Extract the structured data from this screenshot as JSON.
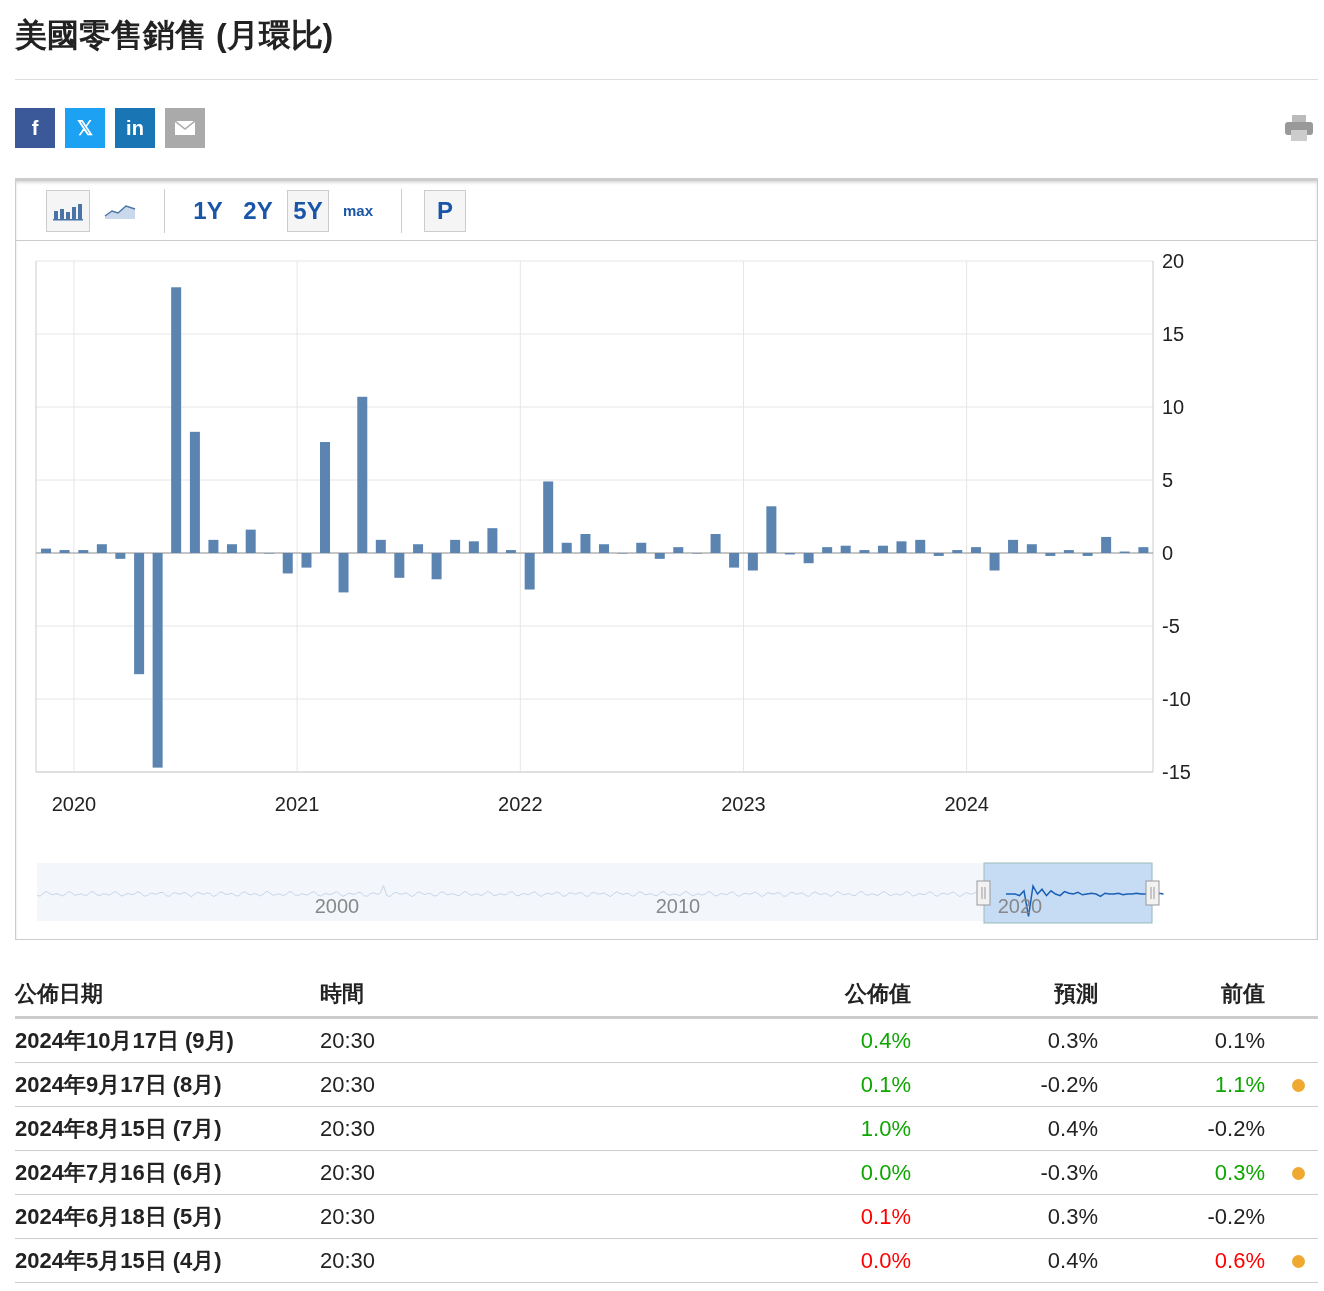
{
  "title": "美國零售銷售 (月環比)",
  "share": [
    {
      "kind": "facebook",
      "label": "f"
    },
    {
      "kind": "x",
      "label": "𝕏"
    },
    {
      "kind": "linkedin",
      "label": "in"
    },
    {
      "kind": "mail"
    }
  ],
  "toolbar": {
    "chart_types": [
      {
        "kind": "bar",
        "selected": true
      },
      {
        "kind": "line",
        "selected": false
      }
    ],
    "ranges": [
      {
        "label": "1Y",
        "selected": false
      },
      {
        "label": "2Y",
        "selected": false
      },
      {
        "label": "5Y",
        "selected": true
      },
      {
        "label": "max",
        "selected": false
      }
    ],
    "extra_button": "P"
  },
  "chart": {
    "chart_data": {
      "type": "bar",
      "grid": true,
      "ylim": [
        -15,
        20
      ],
      "yticks": [
        {
          "value": -15,
          "label": "-15"
        },
        {
          "value": -10,
          "label": "-10"
        },
        {
          "value": -5,
          "label": "-5"
        },
        {
          "value": 0,
          "label": "0"
        },
        {
          "value": 5,
          "label": "5"
        },
        {
          "value": 10,
          "label": "10"
        },
        {
          "value": 15,
          "label": "15"
        },
        {
          "value": 20,
          "label": "20"
        }
      ],
      "xlim": [
        2019.83,
        2024.835
      ],
      "xticks": [
        2020,
        2021,
        2022,
        2023,
        2024
      ],
      "x": [
        2019.875,
        2019.958,
        2020.042,
        2020.125,
        2020.208,
        2020.292,
        2020.375,
        2020.458,
        2020.542,
        2020.625,
        2020.708,
        2020.792,
        2020.875,
        2020.958,
        2021.042,
        2021.125,
        2021.208,
        2021.292,
        2021.375,
        2021.458,
        2021.542,
        2021.625,
        2021.708,
        2021.792,
        2021.875,
        2021.958,
        2022.042,
        2022.125,
        2022.208,
        2022.292,
        2022.375,
        2022.458,
        2022.542,
        2022.625,
        2022.708,
        2022.792,
        2022.875,
        2022.958,
        2023.042,
        2023.125,
        2023.208,
        2023.292,
        2023.375,
        2023.458,
        2023.542,
        2023.625,
        2023.708,
        2023.792,
        2023.875,
        2023.958,
        2024.042,
        2024.125,
        2024.208,
        2024.292,
        2024.375,
        2024.458,
        2024.542,
        2024.625,
        2024.708,
        2024.792
      ],
      "series": [
        {
          "color": "#5b84b1",
          "values": [
            0.3,
            0.2,
            0.2,
            0.6,
            -0.4,
            -8.3,
            -14.7,
            18.2,
            8.3,
            0.9,
            0.6,
            1.6,
            0.0,
            -1.4,
            -1.0,
            7.6,
            -2.7,
            10.7,
            0.9,
            -1.7,
            0.6,
            -1.8,
            0.9,
            0.8,
            1.7,
            0.2,
            -2.5,
            4.9,
            0.7,
            1.3,
            0.6,
            0.0,
            0.7,
            -0.4,
            0.4,
            0.0,
            1.3,
            -1.0,
            -1.2,
            3.2,
            -0.1,
            -0.7,
            0.4,
            0.5,
            0.2,
            0.5,
            0.8,
            0.9,
            -0.2,
            0.2,
            0.4,
            -1.2,
            0.9,
            0.6,
            -0.2,
            0.2,
            -0.2,
            1.1,
            0.1,
            0.4
          ]
        }
      ]
    },
    "navigator_labels": [
      "2000",
      "2010",
      "2020"
    ]
  },
  "table": {
    "columns": [
      "公佈日期",
      "時間",
      "公佈值",
      "預測",
      "前值"
    ],
    "rows": [
      {
        "date": "2024年10月17日 (9月)",
        "time": "20:30",
        "actual": {
          "text": "0.4%",
          "color": "#0ea600"
        },
        "forecast": "0.3%",
        "previous": {
          "text": "0.1%",
          "color": "#222222"
        },
        "revised": false
      },
      {
        "date": "2024年9月17日 (8月)",
        "time": "20:30",
        "actual": {
          "text": "0.1%",
          "color": "#0ea600"
        },
        "forecast": "-0.2%",
        "previous": {
          "text": "1.1%",
          "color": "#0ea600"
        },
        "revised": true
      },
      {
        "date": "2024年8月15日 (7月)",
        "time": "20:30",
        "actual": {
          "text": "1.0%",
          "color": "#0ea600"
        },
        "forecast": "0.4%",
        "previous": {
          "text": "-0.2%",
          "color": "#222222"
        },
        "revised": false
      },
      {
        "date": "2024年7月16日 (6月)",
        "time": "20:30",
        "actual": {
          "text": "0.0%",
          "color": "#0ea600"
        },
        "forecast": "-0.3%",
        "previous": {
          "text": "0.3%",
          "color": "#0ea600"
        },
        "revised": true
      },
      {
        "date": "2024年6月18日 (5月)",
        "time": "20:30",
        "actual": {
          "text": "0.1%",
          "color": "#ff0000"
        },
        "forecast": "0.3%",
        "previous": {
          "text": "-0.2%",
          "color": "#222222"
        },
        "revised": false
      },
      {
        "date": "2024年5月15日 (4月)",
        "time": "20:30",
        "actual": {
          "text": "0.0%",
          "color": "#ff0000"
        },
        "forecast": "0.4%",
        "previous": {
          "text": "0.6%",
          "color": "#ff0000"
        },
        "revised": true
      }
    ]
  }
}
